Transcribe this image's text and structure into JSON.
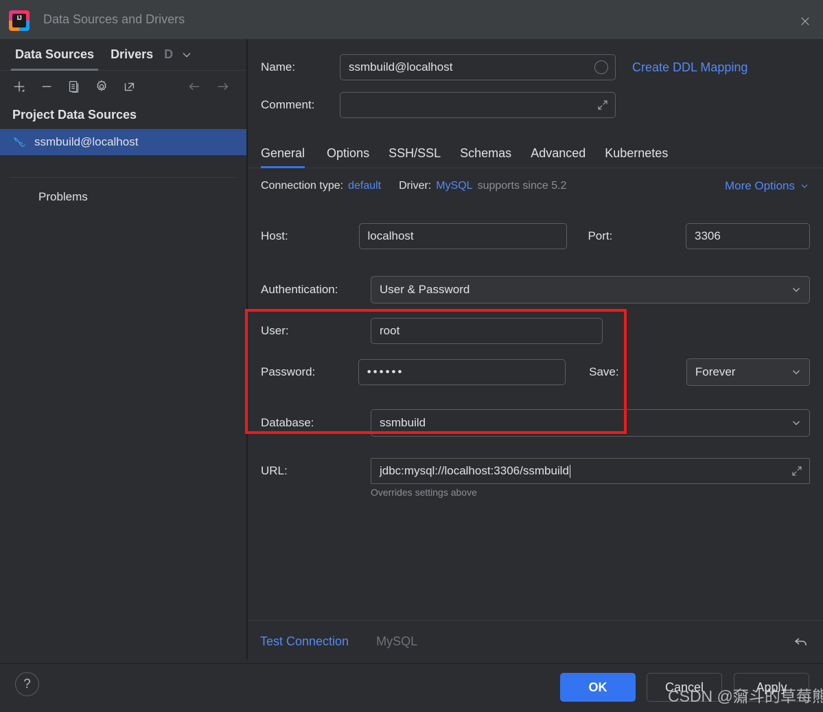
{
  "window": {
    "title": "Data Sources and Drivers",
    "logo_text": "IJ",
    "close_icon": "close-icon"
  },
  "sidebar": {
    "tabs": [
      {
        "label": "Data Sources",
        "active": true
      },
      {
        "label": "Drivers",
        "active": false
      },
      {
        "label": "D",
        "active": false,
        "truncated": true
      }
    ],
    "overflow_icon": "chevron-down-icon",
    "toolbar": [
      {
        "name": "add-icon",
        "glyph": "+"
      },
      {
        "name": "remove-icon",
        "glyph": "−"
      },
      {
        "name": "duplicate-icon",
        "glyph": "copy"
      },
      {
        "name": "settings-gear-icon",
        "glyph": "gear"
      },
      {
        "name": "open-external-icon",
        "glyph": "external"
      }
    ],
    "nav": [
      {
        "name": "back-arrow-icon",
        "glyph": "←"
      },
      {
        "name": "forward-arrow-icon",
        "glyph": "→"
      }
    ],
    "group_title": "Project Data Sources",
    "items": [
      {
        "label": "ssmbuild@localhost",
        "icon": "mysql-dolphin-icon",
        "selected": true
      }
    ],
    "problems_label": "Problems"
  },
  "detail": {
    "name_label": "Name:",
    "name_value": "ssmbuild@localhost",
    "create_ddl_link": "Create DDL Mapping",
    "comment_label": "Comment:",
    "comment_value": "",
    "tabs": [
      {
        "label": "General",
        "active": true
      },
      {
        "label": "Options",
        "active": false
      },
      {
        "label": "SSH/SSL",
        "active": false
      },
      {
        "label": "Schemas",
        "active": false
      },
      {
        "label": "Advanced",
        "active": false
      },
      {
        "label": "Kubernetes",
        "active": false
      }
    ],
    "connection_type_label": "Connection type:",
    "connection_type_value": "default",
    "driver_label": "Driver:",
    "driver_value": "MySQL",
    "driver_note": "supports since 5.2",
    "more_options_label": "More Options",
    "host_label": "Host:",
    "host_value": "localhost",
    "port_label": "Port:",
    "port_value": "3306",
    "auth_label": "Authentication:",
    "auth_value": "User & Password",
    "user_label": "User:",
    "user_value": "root",
    "password_label": "Password:",
    "password_value": "••••••",
    "save_label": "Save:",
    "save_value": "Forever",
    "database_label": "Database:",
    "database_value": "ssmbuild",
    "url_label": "URL:",
    "url_value": "jdbc:mysql://localhost:3306/ssmbuild",
    "url_hint": "Overrides settings above"
  },
  "test_bar": {
    "test_connection_label": "Test Connection",
    "driver_name": "MySQL",
    "revert_icon": "revert-arrow-icon"
  },
  "footer": {
    "help_glyph": "?",
    "ok_label": "OK",
    "cancel_label": "Cancel",
    "apply_label": "Apply"
  },
  "watermark": "CSDN @奫斗的草莓熊",
  "colors": {
    "accent_blue": "#3574f0",
    "link_blue": "#548af7",
    "selection_blue": "#2f5093",
    "annotation_red": "#f01a1a",
    "panel_bg": "#2b2d30",
    "titlebar_bg": "#3c3f41"
  }
}
